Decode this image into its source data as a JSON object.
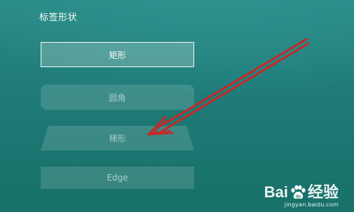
{
  "section": {
    "title": "标签形状"
  },
  "options": [
    {
      "label": "矩形",
      "state": "selected"
    },
    {
      "label": "圆角",
      "state": "normal"
    },
    {
      "label": "梯形",
      "state": "normal"
    },
    {
      "label": "Edge",
      "state": "normal"
    }
  ],
  "annotation": {
    "type": "arrow",
    "color": "#c62828",
    "points_to": "梯形"
  },
  "watermark": {
    "logo_text_left": "Bai",
    "logo_text_right": "经验",
    "url": "jingyan.baidu.com",
    "icon": "baidu-paw-icon"
  },
  "colors": {
    "background": "#1f7b77",
    "selected_border": "#ffffff"
  }
}
